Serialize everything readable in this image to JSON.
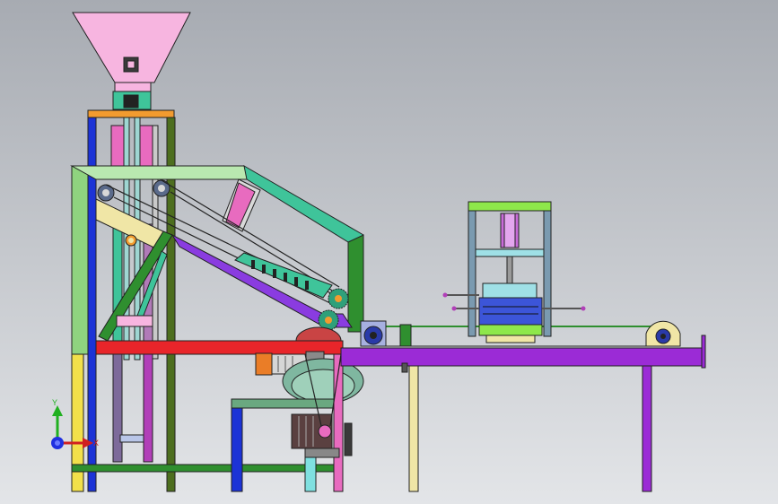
{
  "viewport": {
    "background_top": "#a7abb2",
    "background_bottom": "#e3e5e8"
  },
  "triad": {
    "y_label": "Y",
    "x_label": "X",
    "y_color": "#20b020",
    "x_color": "#d02020",
    "z_color": "#2030e0"
  },
  "colors": {
    "hopper": "#f7b5e0",
    "outline": "#222222",
    "leg_yellow": "#f2e04a",
    "leg_blue": "#1c33d6",
    "leg_darkgreen": "#4d6e1f",
    "top_plate": "#f29b2f",
    "frame_lightgreen": "#b9e8b0",
    "frame_teal": "#3fc49a",
    "frame_green": "#2f8f2f",
    "frame_purple": "#8a3ce0",
    "beam_red": "#e8252a",
    "table": "#9b2bd6",
    "cream": "#f0e6a6",
    "press_lime": "#8ee84b",
    "press_steel": "#7a9ab0",
    "press_cyan": "#9fe0e6",
    "press_blue": "#3c55d8",
    "motor": "#7a5a4a",
    "motor_orange": "#ea7d27",
    "gear": "#2fa07a",
    "pink": "#e86bbf"
  }
}
